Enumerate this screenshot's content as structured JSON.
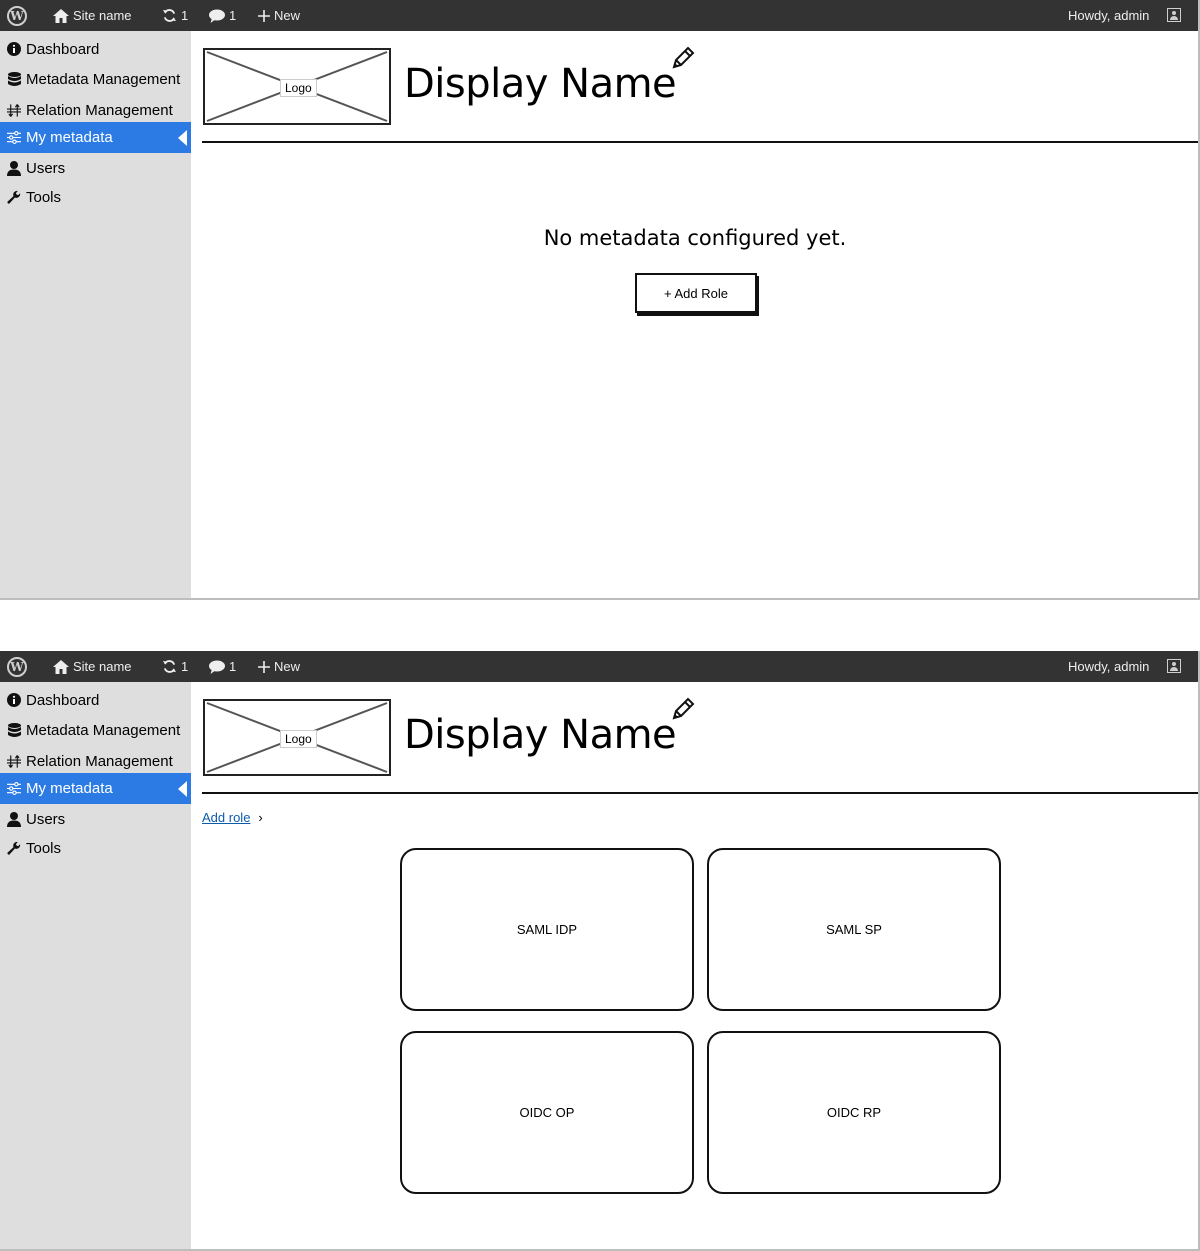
{
  "admin_bar": {
    "site_name": "Site name",
    "updates_count": "1",
    "comments_count": "1",
    "new_label": "New",
    "howdy": "Howdy, admin"
  },
  "sidebar": {
    "items": [
      {
        "label": "Dashboard",
        "icon": "info-icon"
      },
      {
        "label": "Metadata Management",
        "icon": "database-icon"
      },
      {
        "label": "Relation Management",
        "icon": "relation-arrows-icon"
      },
      {
        "label": "My metadata",
        "icon": "sliders-icon",
        "active": true
      },
      {
        "label": "Users",
        "icon": "user-icon"
      },
      {
        "label": "Tools",
        "icon": "wrench-icon"
      }
    ],
    "active_color": "#2c7be5"
  },
  "header": {
    "logo_label": "Logo",
    "display_name": "Display Name"
  },
  "screen1": {
    "empty_message": "No metadata configured yet.",
    "add_role_button": "+ Add Role"
  },
  "screen2": {
    "breadcrumb_link": "Add role",
    "breadcrumb_sep": "›",
    "cards": [
      "SAML IDP",
      "SAML SP",
      "OIDC OP",
      "OIDC RP"
    ]
  }
}
